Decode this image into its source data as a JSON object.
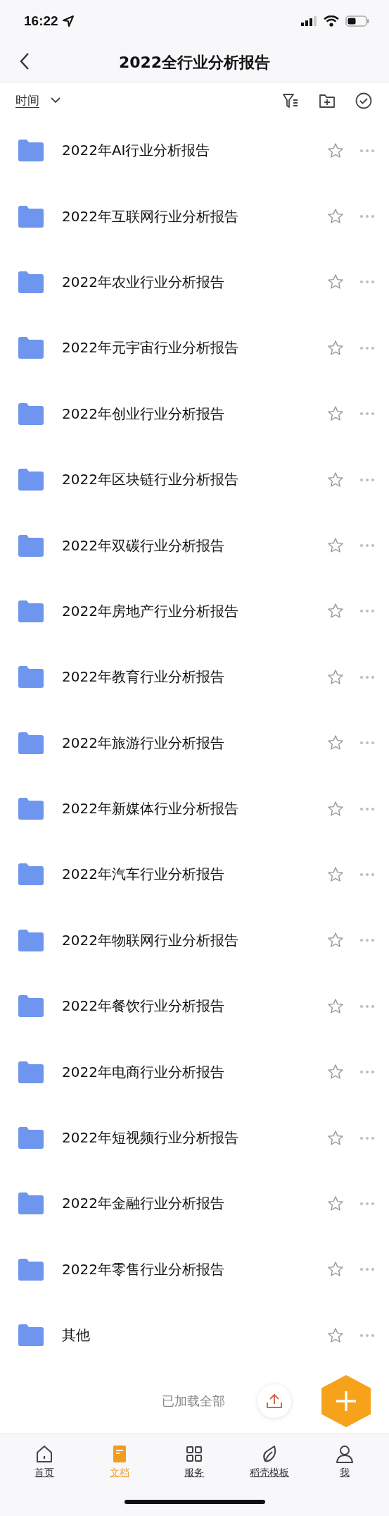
{
  "status_bar": {
    "time": "16:22"
  },
  "nav": {
    "title": "2022全行业分析报告"
  },
  "toolbar": {
    "sort_label": "时间"
  },
  "folders": [
    {
      "name": "2022年AI行业分析报告",
      "starred": false
    },
    {
      "name": "2022年互联网行业分析报告",
      "starred": false
    },
    {
      "name": "2022年农业行业分析报告",
      "starred": false
    },
    {
      "name": "2022年元宇宙行业分析报告",
      "starred": false
    },
    {
      "name": "2022年创业行业分析报告",
      "starred": false
    },
    {
      "name": "2022年区块链行业分析报告",
      "starred": false
    },
    {
      "name": "2022年双碳行业分析报告",
      "starred": false
    },
    {
      "name": "2022年房地产行业分析报告",
      "starred": false
    },
    {
      "name": "2022年教育行业分析报告",
      "starred": false
    },
    {
      "name": "2022年旅游行业分析报告",
      "starred": false
    },
    {
      "name": "2022年新媒体行业分析报告",
      "starred": false
    },
    {
      "name": "2022年汽车行业分析报告",
      "starred": false
    },
    {
      "name": "2022年物联网行业分析报告",
      "starred": false
    },
    {
      "name": "2022年餐饮行业分析报告",
      "starred": false
    },
    {
      "name": "2022年电商行业分析报告",
      "starred": false
    },
    {
      "name": "2022年短视频行业分析报告",
      "starred": false
    },
    {
      "name": "2022年金融行业分析报告",
      "starred": false
    },
    {
      "name": "2022年零售行业分析报告",
      "starred": false
    },
    {
      "name": "其他",
      "starred": false
    }
  ],
  "footer": {
    "text": "已加载全部"
  },
  "tab_bar": [
    {
      "kind": "home",
      "label": "首页",
      "selected": false
    },
    {
      "kind": "docs",
      "label": "文档",
      "selected": true
    },
    {
      "kind": "services",
      "label": "服务",
      "selected": false
    },
    {
      "kind": "templates",
      "label": "稻壳模板",
      "selected": false
    },
    {
      "kind": "me",
      "label": "我",
      "selected": false
    }
  ]
}
